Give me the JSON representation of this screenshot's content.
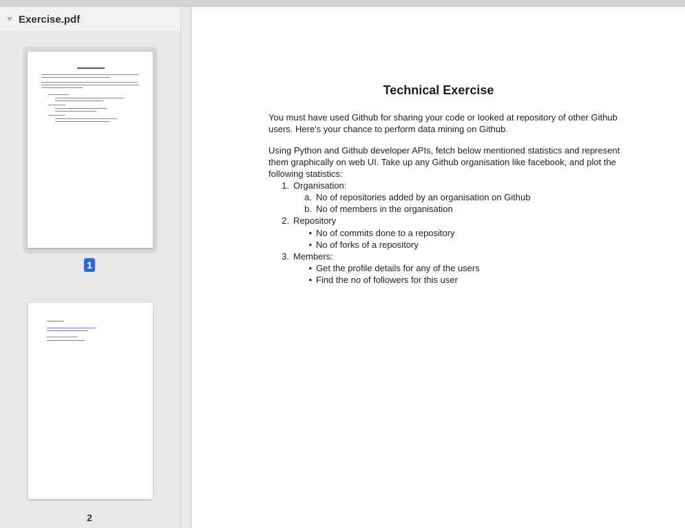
{
  "sidebar": {
    "file_name": "Exercise.pdf",
    "pages": [
      {
        "number": "1",
        "selected": true
      },
      {
        "number": "2",
        "selected": false
      }
    ]
  },
  "document": {
    "title": "Technical Exercise",
    "paragraph1": "You must have used Github for sharing your code or looked at repository of other Github users. Here's your chance to perform data mining on Github.",
    "paragraph2": "Using Python and Github developer APIs, fetch below mentioned statistics and represent them graphically on web UI. Take up any Github organisation like facebook, and plot the following statistics:",
    "items": [
      {
        "marker": "1.",
        "text": "Organisation:"
      },
      {
        "marker": "a.",
        "text": "No of repositories added by an organisation on Github"
      },
      {
        "marker": "b.",
        "text": "No of members in the organisation"
      },
      {
        "marker": "2.",
        "text": "Repository"
      },
      {
        "marker": "•",
        "text": "No of commits done to a repository"
      },
      {
        "marker": "•",
        "text": "No of forks of a repository"
      },
      {
        "marker": "3.",
        "text": "Members:"
      },
      {
        "marker": "•",
        "text": "Get the profile details for any of the users"
      },
      {
        "marker": "•",
        "text": "Find the no of followers for this user"
      }
    ]
  },
  "colors": {
    "selected_page_badge": "#2d67d8",
    "thumbnail_link": "#6b7fc2"
  },
  "icons": {
    "disclosure": "disclosure-triangle-icon"
  }
}
